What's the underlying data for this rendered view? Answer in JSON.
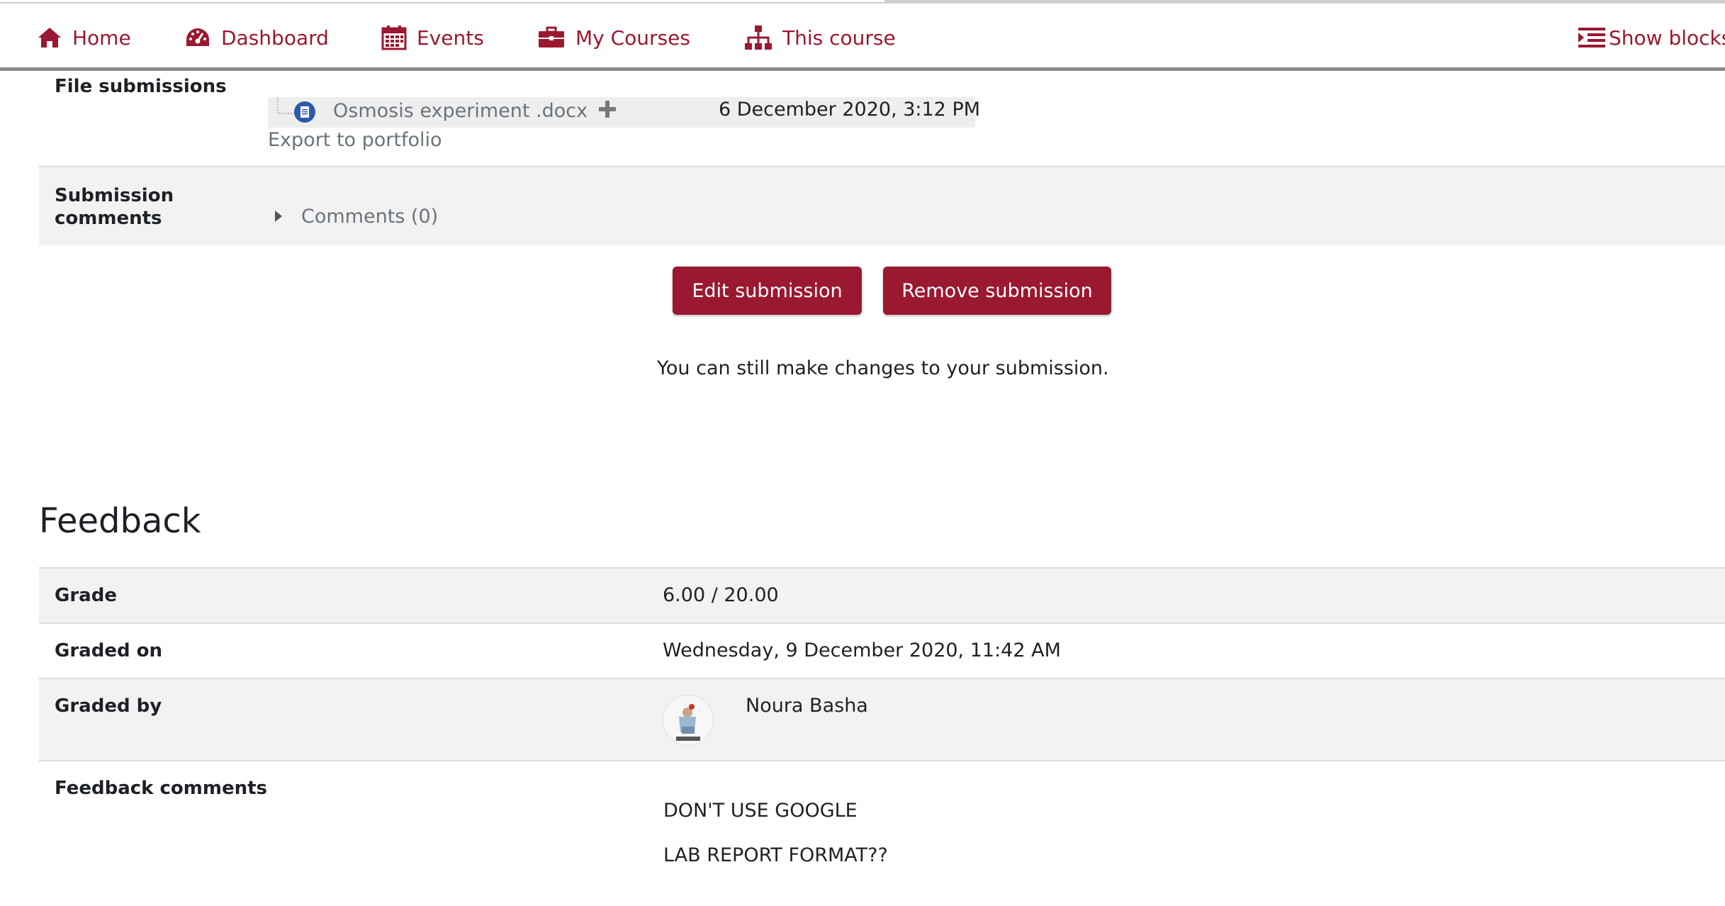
{
  "nav": {
    "home": "Home",
    "dashboard": "Dashboard",
    "events": "Events",
    "my_courses": "My Courses",
    "this_course": "This course",
    "show_blocks": "Show blocks"
  },
  "submission": {
    "file_label": "File submissions",
    "file_name": "Osmosis experiment .docx",
    "file_date": "6 December 2020, 3:12 PM",
    "export_link": "Export to portfolio",
    "comments_label_1": "Submission",
    "comments_label_2": "comments",
    "comments_toggle": "Comments (0)",
    "edit_button": "Edit submission",
    "remove_button": "Remove submission",
    "changes_note": "You can still make changes to your submission."
  },
  "feedback": {
    "title": "Feedback",
    "grade_label": "Grade",
    "grade_value": "6.00 / 20.00",
    "graded_on_label": "Graded on",
    "graded_on_value": "Wednesday, 9 December 2020, 11:42 AM",
    "graded_by_label": "Graded by",
    "graded_by_value": "Noura Basha",
    "comments_label": "Feedback comments",
    "comment_line_1": "DON'T USE GOOGLE",
    "comment_line_2": "LAB REPORT FORMAT??"
  },
  "colors": {
    "brand": "#9a1830",
    "row_grey": "#f2f2f2"
  }
}
